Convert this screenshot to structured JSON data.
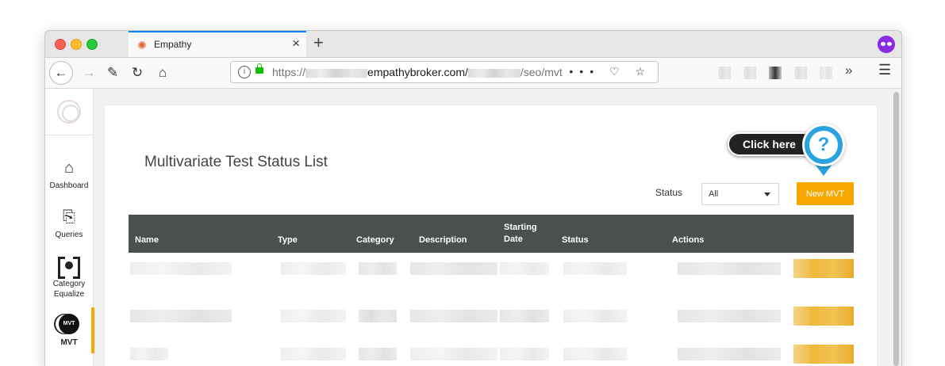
{
  "browser": {
    "tab_title": "Empathy",
    "new_tab_label": "+",
    "url_prefix": "https://",
    "url_host": "empathybroker.com/",
    "url_path": "/seo/mvt",
    "url_actions": "••• ♡ ☆"
  },
  "sidebar": {
    "items": [
      {
        "label": "Dashboard",
        "icon": "home-icon"
      },
      {
        "label": "Queries",
        "icon": "queries-icon"
      },
      {
        "label": "Category\nEqualize",
        "icon": "category-equalize-icon"
      },
      {
        "label": "MVT",
        "icon": "mvt-icon",
        "icon_text": "MVT",
        "active": true
      }
    ]
  },
  "page": {
    "title": "Multivariate Test Status List",
    "status_label": "Status",
    "status_value": "All",
    "new_button": "New MVT",
    "help_callout": "Click here",
    "help_icon_text": "?"
  },
  "table": {
    "columns": [
      "Name",
      "Type",
      "Category",
      "Description",
      "Starting\nDate",
      "Status",
      "Actions"
    ]
  },
  "colors": {
    "accent": "#f5a800",
    "header_bg": "#4b4f50",
    "help_blue": "#29a3e0"
  }
}
